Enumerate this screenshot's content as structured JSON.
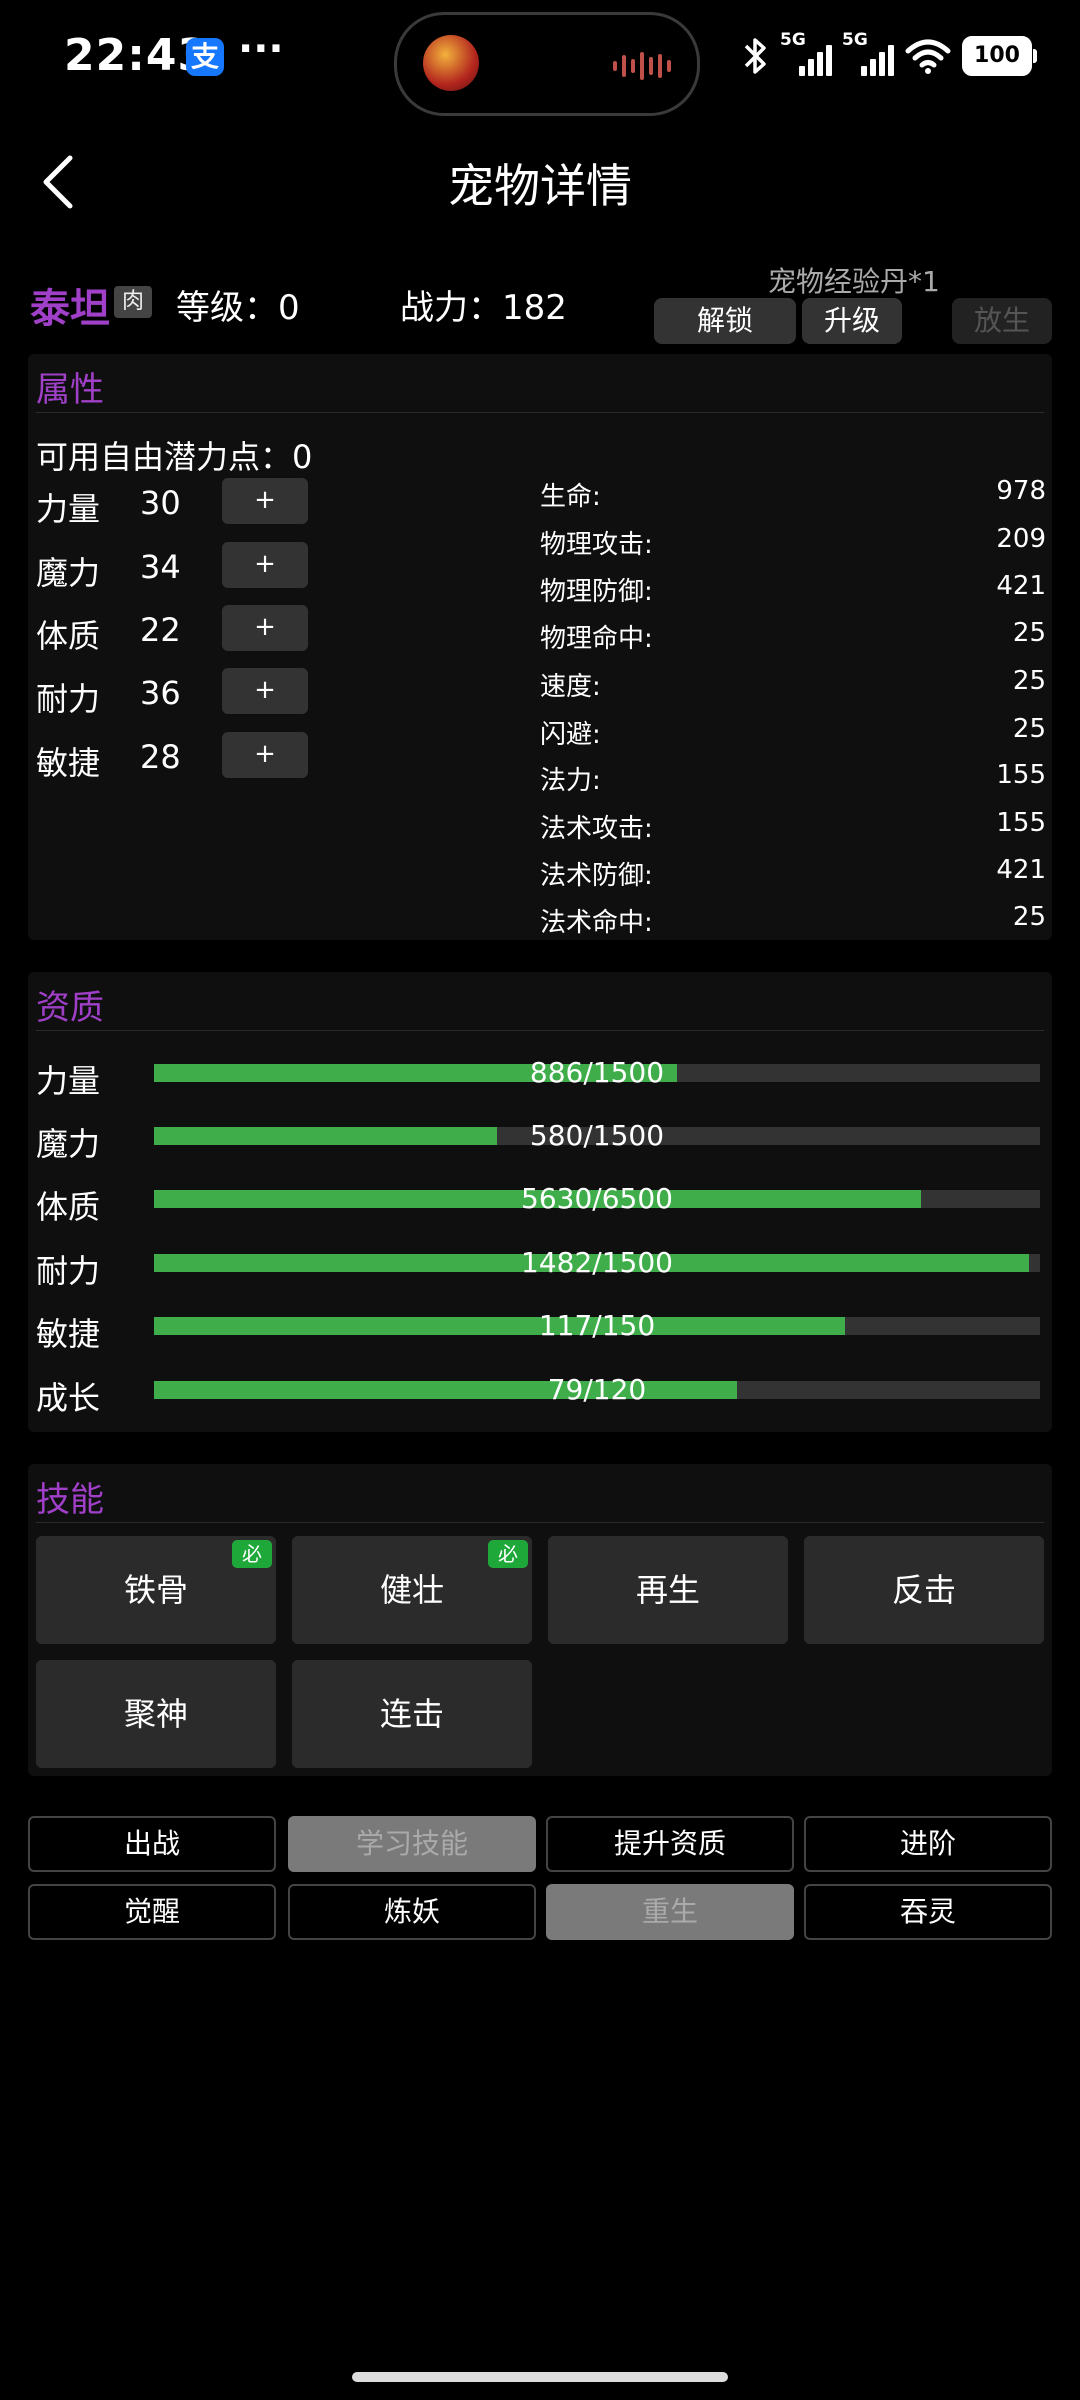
{
  "status_bar": {
    "time": "22:43",
    "alipay_icon": "支",
    "more": "···",
    "signal1_label": "5G",
    "signal2_label": "5G",
    "battery": "100"
  },
  "header": {
    "title": "宠物详情"
  },
  "pet": {
    "name": "泰坦",
    "tag": "肉",
    "level_text": "等级：0",
    "power_text": "战力：182",
    "exp_item": "宠物经验丹*1",
    "buttons": {
      "unlock": "解锁",
      "upgrade": "升级",
      "release": "放生"
    }
  },
  "attributes": {
    "title": "属性",
    "free_points": "可用自由潜力点：0",
    "base": [
      {
        "label": "力量",
        "value": "30",
        "plus": "+"
      },
      {
        "label": "魔力",
        "value": "34",
        "plus": "+"
      },
      {
        "label": "体质",
        "value": "22",
        "plus": "+"
      },
      {
        "label": "耐力",
        "value": "36",
        "plus": "+"
      },
      {
        "label": "敏捷",
        "value": "28",
        "plus": "+"
      }
    ],
    "stats": [
      {
        "label": "生命:",
        "value": "978"
      },
      {
        "label": "物理攻击:",
        "value": "209"
      },
      {
        "label": "物理防御:",
        "value": "421"
      },
      {
        "label": "物理命中:",
        "value": "25"
      },
      {
        "label": "速度:",
        "value": "25"
      },
      {
        "label": "闪避:",
        "value": "25"
      },
      {
        "label": "法力:",
        "value": "155"
      },
      {
        "label": "法术攻击:",
        "value": "155"
      },
      {
        "label": "法术防御:",
        "value": "421"
      },
      {
        "label": "法术命中:",
        "value": "25"
      }
    ]
  },
  "aptitude": {
    "title": "资质",
    "rows": [
      {
        "label": "力量",
        "text": "886/1500",
        "current": 886,
        "max": 1500
      },
      {
        "label": "魔力",
        "text": "580/1500",
        "current": 580,
        "max": 1500
      },
      {
        "label": "体质",
        "text": "5630/6500",
        "current": 5630,
        "max": 6500
      },
      {
        "label": "耐力",
        "text": "1482/1500",
        "current": 1482,
        "max": 1500
      },
      {
        "label": "敏捷",
        "text": "117/150",
        "current": 117,
        "max": 150
      },
      {
        "label": "成长",
        "text": "79/120",
        "current": 79,
        "max": 120
      }
    ]
  },
  "skills": {
    "title": "技能",
    "must_badge": "必",
    "items": [
      {
        "label": "铁骨",
        "must": true
      },
      {
        "label": "健壮",
        "must": true
      },
      {
        "label": "再生",
        "must": false
      },
      {
        "label": "反击",
        "must": false
      },
      {
        "label": "聚神",
        "must": false
      },
      {
        "label": "连击",
        "must": false
      }
    ]
  },
  "actions": {
    "row1": [
      {
        "label": "出战",
        "disabled": false
      },
      {
        "label": "学习技能",
        "disabled": true
      },
      {
        "label": "提升资质",
        "disabled": false
      },
      {
        "label": "进阶",
        "disabled": false
      }
    ],
    "row2": [
      {
        "label": "觉醒",
        "disabled": false
      },
      {
        "label": "炼妖",
        "disabled": false
      },
      {
        "label": "重生",
        "disabled": true
      },
      {
        "label": "吞灵",
        "disabled": false
      }
    ]
  },
  "colors": {
    "accent_purple": "#a040c8",
    "bar_green": "#3fae4a",
    "badge_green": "#1fa83a",
    "background": "#000000"
  }
}
